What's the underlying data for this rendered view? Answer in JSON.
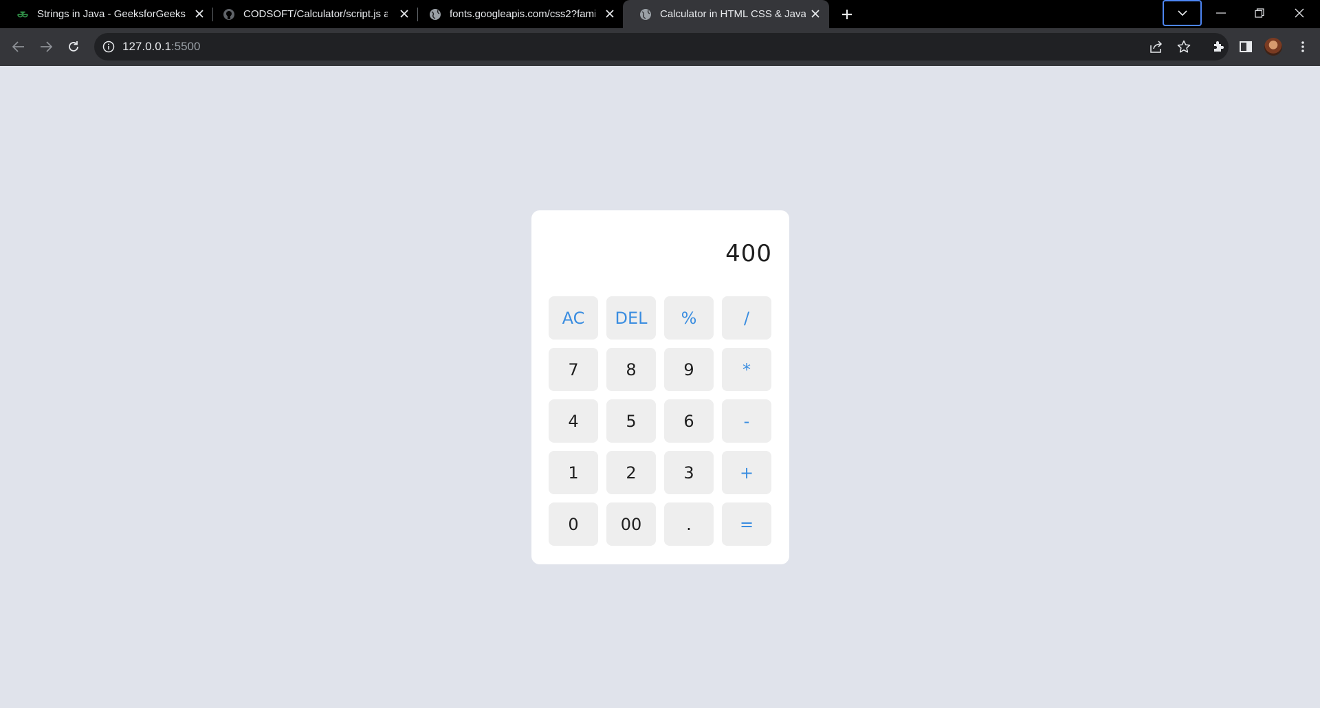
{
  "browser": {
    "tabs": [
      {
        "title": "Strings in Java - GeeksforGeeks",
        "icon": "geeksforgeeks-icon",
        "active": false
      },
      {
        "title": "CODSOFT/Calculator/script.js at",
        "icon": "github-icon",
        "active": false
      },
      {
        "title": "fonts.googleapis.com/css2?fami",
        "icon": "globe-icon",
        "active": false
      },
      {
        "title": "Calculator in HTML CSS & JavaS",
        "icon": "globe-icon",
        "active": true
      }
    ],
    "address": {
      "host": "127.0.0.1",
      "port": ":5500"
    }
  },
  "calculator": {
    "display": "400",
    "keys": [
      {
        "label": "AC",
        "type": "operator"
      },
      {
        "label": "DEL",
        "type": "operator"
      },
      {
        "label": "%",
        "type": "operator"
      },
      {
        "label": "/",
        "type": "operator"
      },
      {
        "label": "7",
        "type": "digit"
      },
      {
        "label": "8",
        "type": "digit"
      },
      {
        "label": "9",
        "type": "digit"
      },
      {
        "label": "*",
        "type": "operator"
      },
      {
        "label": "4",
        "type": "digit"
      },
      {
        "label": "5",
        "type": "digit"
      },
      {
        "label": "6",
        "type": "digit"
      },
      {
        "label": "-",
        "type": "operator"
      },
      {
        "label": "1",
        "type": "digit"
      },
      {
        "label": "2",
        "type": "digit"
      },
      {
        "label": "3",
        "type": "digit"
      },
      {
        "label": "+",
        "type": "operator"
      },
      {
        "label": "0",
        "type": "digit"
      },
      {
        "label": "00",
        "type": "digit"
      },
      {
        "label": ".",
        "type": "digit"
      },
      {
        "label": "=",
        "type": "operator"
      }
    ]
  },
  "colors": {
    "page_background": "#e0e3eb",
    "calculator_background": "#ffffff",
    "key_background": "#eeeeee",
    "operator_accent": "#3a8de0",
    "tabstrip": "#000000",
    "toolbar": "#35363a"
  }
}
